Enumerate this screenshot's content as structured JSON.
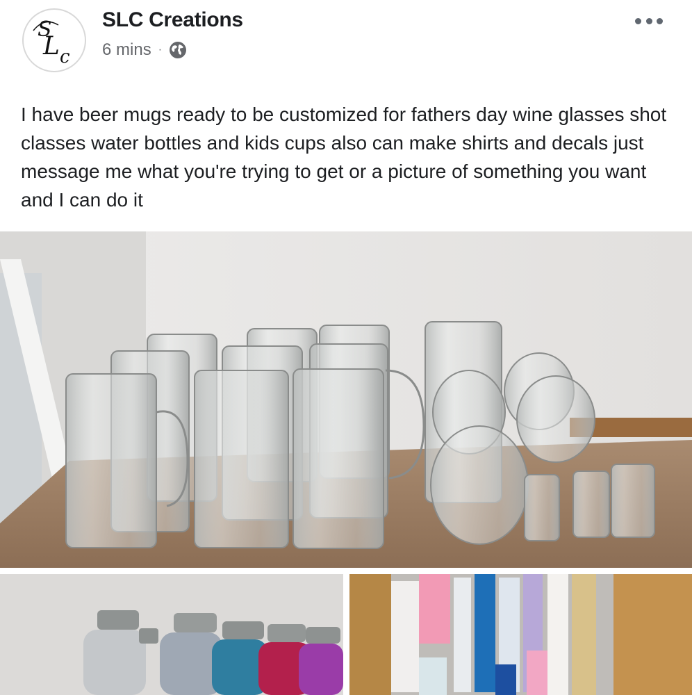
{
  "post": {
    "author": "SLC Creations",
    "time": "6 mins",
    "separator": "·",
    "privacy_icon": "globe-icon",
    "more_icon": "more-options-icon",
    "text": "I have beer mugs ready to be customized for fathers day wine glasses shot classes water bottles and kids cups also can make shirts and decals just message me what you're trying to get or a picture of something you want and I can do it"
  },
  "avatar": {
    "monogram": "SLC"
  },
  "photos": [
    {
      "subject": "glass mugs and glasses"
    },
    {
      "subject": "water bottles"
    },
    {
      "subject": "vinyl rolls"
    }
  ],
  "colors": {
    "name": "#1c1e21",
    "meta": "#65676b",
    "icon": "#606770"
  }
}
